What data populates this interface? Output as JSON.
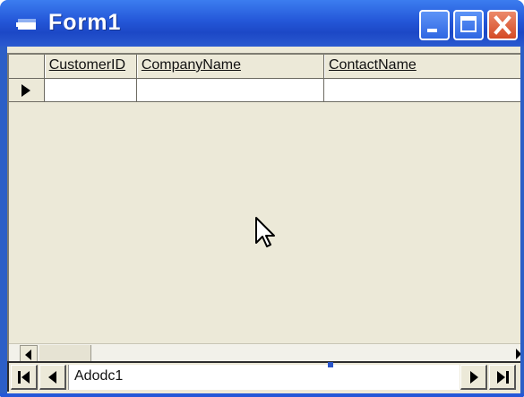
{
  "window": {
    "title": "Form1",
    "colors": {
      "titlebar": "#2457d8",
      "client": "#ece9d8",
      "close": "#d44a25"
    },
    "controls": {
      "minimize_icon": "minimize-icon",
      "maximize_icon": "maximize-icon",
      "close_icon": "close-icon"
    }
  },
  "grid": {
    "columns": [
      {
        "label": "CustomerID"
      },
      {
        "label": "CompanyName"
      },
      {
        "label": "ContactName"
      }
    ],
    "current_row_indicator": "row-pointer-icon",
    "rows": [
      {
        "cells": [
          "",
          "",
          ""
        ]
      }
    ]
  },
  "adodc": {
    "caption": "Adodc1",
    "buttons": {
      "first": "move-first-icon",
      "previous": "move-previous-icon",
      "next": "move-next-icon",
      "last": "move-last-icon"
    }
  }
}
